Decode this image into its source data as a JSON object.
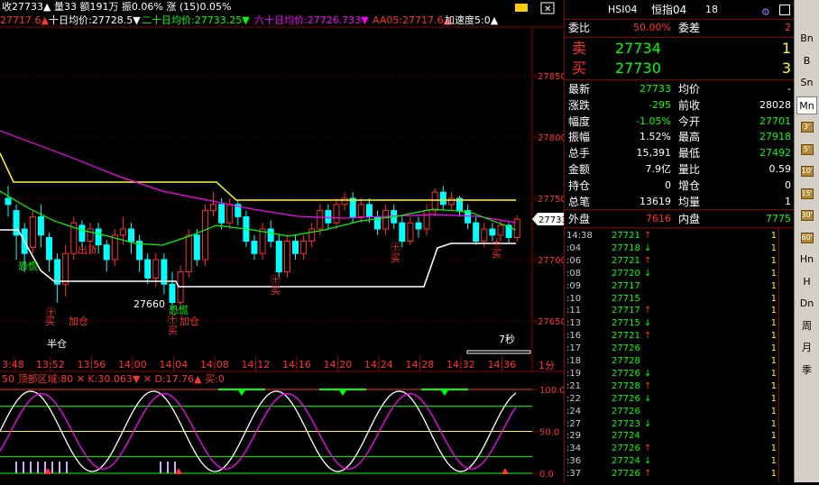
{
  "header": {
    "row1": "收27733▲ 量33 额191万 振0.06% 涨 (15)0.05%",
    "ma_prefix": "27717.6▲",
    "ma10": "十日均价:27728.5▼",
    "ma20": "二十日均价:27733.25▼",
    "ma60": "六十日均价:27726.733▼",
    "aa05": "AA05:27717.6▲",
    "accel": "加速度5:0▲"
  },
  "price_axis": [
    "27850",
    "27800",
    "27750",
    "27700",
    "27650"
  ],
  "current_price_tag": "27733",
  "time_axis": [
    "3:48",
    "13:52",
    "13:56",
    "14:00",
    "14:04",
    "14:08",
    "14:12",
    "14:16",
    "14:20",
    "14:24",
    "14:28",
    "14:32",
    "14:36"
  ],
  "period_label": "1分",
  "seconds_label": "7秒",
  "annotations": {
    "chuhuo": "出货",
    "konghuang1": "恐慌",
    "konghuang2": "恐慌",
    "jiacang": "加仓",
    "jiacang2": "加仓",
    "bancang": "半仓",
    "low_price": "27660",
    "buy": "买",
    "circle": "㊉"
  },
  "indicator": {
    "header": "50 顶部区域:80 ✕ K:30.063▼ ✕ D:17.76▲ 买:0",
    "levels": [
      "100.0",
      "50.0",
      "0.0"
    ]
  },
  "quote": {
    "symbol": "HSI04",
    "name": "恒指04",
    "num": "18",
    "weibi_label": "委比",
    "weibi_value": "50.00%",
    "weicha_label": "委差",
    "weicha_value": "2",
    "sell_label": "卖",
    "sell_price": "27734",
    "sell_vol": "1",
    "buy_label": "买",
    "buy_price": "27730",
    "buy_vol": "3",
    "rows": [
      {
        "l1": "最新",
        "v1": "27733",
        "c1": "#00ff00",
        "l2": "均价",
        "v2": "-",
        "c2": "#fff"
      },
      {
        "l1": "涨跌",
        "v1": "-295",
        "c1": "#00ff00",
        "l2": "前收",
        "v2": "28028",
        "c2": "#fff"
      },
      {
        "l1": "幅度",
        "v1": "-1.05%",
        "c1": "#00ff00",
        "l2": "今开",
        "v2": "27701",
        "c2": "#00ff00"
      },
      {
        "l1": "振幅",
        "v1": "1.52%",
        "c1": "#fff",
        "l2": "最高",
        "v2": "27918",
        "c2": "#00ff00"
      },
      {
        "l1": "总手",
        "v1": "15,391",
        "c1": "#fff",
        "l2": "最低",
        "v2": "27492",
        "c2": "#00ff00"
      },
      {
        "l1": "金额",
        "v1": "7.9亿",
        "c1": "#fff",
        "l2": "量比",
        "v2": "0.59",
        "c2": "#fff"
      },
      {
        "l1": "持仓",
        "v1": "0",
        "c1": "#fff",
        "l2": "增仓",
        "v2": "0",
        "c2": "#fff"
      },
      {
        "l1": "总笔",
        "v1": "13619",
        "c1": "#fff",
        "l2": "均量",
        "v2": "1",
        "c2": "#fff"
      }
    ],
    "outer_label": "外盘",
    "outer_value": "7616",
    "inner_label": "内盘",
    "inner_value": "7775",
    "ticks": [
      {
        "t": "14:38",
        "p": "27721",
        "d": "↑",
        "v": "1"
      },
      {
        "t": ":04",
        "p": "27718",
        "d": "↓",
        "v": "1"
      },
      {
        "t": ":06",
        "p": "27721",
        "d": "↑",
        "v": "1"
      },
      {
        "t": ":08",
        "p": "27720",
        "d": "↓",
        "v": "1"
      },
      {
        "t": ":09",
        "p": "27717",
        "d": "",
        "v": "1"
      },
      {
        "t": ":10",
        "p": "27715",
        "d": "",
        "v": "1"
      },
      {
        "t": ":11",
        "p": "27717",
        "d": "↑",
        "v": "1"
      },
      {
        "t": ":13",
        "p": "27715",
        "d": "↓",
        "v": "1"
      },
      {
        "t": ":16",
        "p": "27721",
        "d": "↑",
        "v": "1"
      },
      {
        "t": ":17",
        "p": "27726",
        "d": "",
        "v": "1"
      },
      {
        "t": ":18",
        "p": "27728",
        "d": "",
        "v": "1"
      },
      {
        "t": ":19",
        "p": "27726",
        "d": "↓",
        "v": "1"
      },
      {
        "t": ":21",
        "p": "27728",
        "d": "↑",
        "v": "1"
      },
      {
        "t": ":22",
        "p": "27726",
        "d": "↓",
        "v": "1"
      },
      {
        "t": ":24",
        "p": "27726",
        "d": "",
        "v": "1"
      },
      {
        "t": ":27",
        "p": "27723",
        "d": "↓",
        "v": "1"
      },
      {
        "t": ":29",
        "p": "27724",
        "d": "",
        "v": "1"
      },
      {
        "t": ":34",
        "p": "27726",
        "d": "↑",
        "v": "1"
      },
      {
        "t": ":36",
        "p": "27724",
        "d": "↓",
        "v": "1"
      },
      {
        "t": ":37",
        "p": "27726",
        "d": "↑",
        "v": "1"
      }
    ]
  },
  "toolbar": [
    "Bn",
    "B",
    "Sn",
    "Mn",
    "3'",
    "5'",
    "10'",
    "15'",
    "30'",
    "60'",
    "Hn",
    "H",
    "Dn",
    "周",
    "月",
    "季"
  ],
  "colors": {
    "up": "#ff3030",
    "down": "#00ffff",
    "ma10": "#ffffff",
    "ma20": "#00ff00",
    "ma60": "#ff00ff",
    "yellow": "#ffff00",
    "grid": "#800000"
  }
}
